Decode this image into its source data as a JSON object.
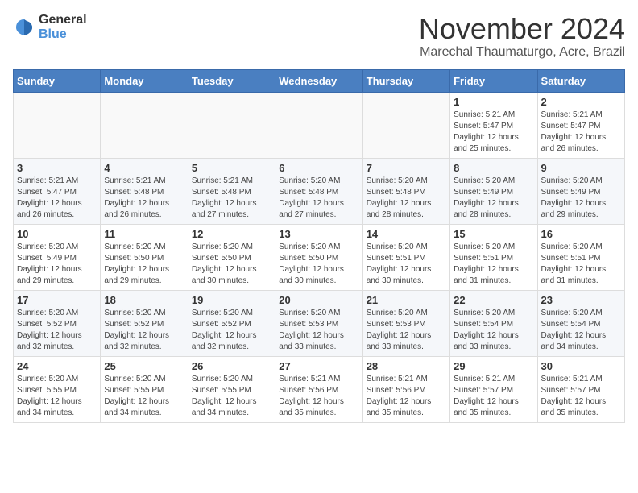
{
  "logo": {
    "general": "General",
    "blue": "Blue"
  },
  "header": {
    "month_year": "November 2024",
    "location": "Marechal Thaumaturgo, Acre, Brazil"
  },
  "weekdays": [
    "Sunday",
    "Monday",
    "Tuesday",
    "Wednesday",
    "Thursday",
    "Friday",
    "Saturday"
  ],
  "weeks": [
    [
      {
        "day": "",
        "info": ""
      },
      {
        "day": "",
        "info": ""
      },
      {
        "day": "",
        "info": ""
      },
      {
        "day": "",
        "info": ""
      },
      {
        "day": "",
        "info": ""
      },
      {
        "day": "1",
        "info": "Sunrise: 5:21 AM\nSunset: 5:47 PM\nDaylight: 12 hours\nand 25 minutes."
      },
      {
        "day": "2",
        "info": "Sunrise: 5:21 AM\nSunset: 5:47 PM\nDaylight: 12 hours\nand 26 minutes."
      }
    ],
    [
      {
        "day": "3",
        "info": "Sunrise: 5:21 AM\nSunset: 5:47 PM\nDaylight: 12 hours\nand 26 minutes."
      },
      {
        "day": "4",
        "info": "Sunrise: 5:21 AM\nSunset: 5:48 PM\nDaylight: 12 hours\nand 26 minutes."
      },
      {
        "day": "5",
        "info": "Sunrise: 5:21 AM\nSunset: 5:48 PM\nDaylight: 12 hours\nand 27 minutes."
      },
      {
        "day": "6",
        "info": "Sunrise: 5:20 AM\nSunset: 5:48 PM\nDaylight: 12 hours\nand 27 minutes."
      },
      {
        "day": "7",
        "info": "Sunrise: 5:20 AM\nSunset: 5:48 PM\nDaylight: 12 hours\nand 28 minutes."
      },
      {
        "day": "8",
        "info": "Sunrise: 5:20 AM\nSunset: 5:49 PM\nDaylight: 12 hours\nand 28 minutes."
      },
      {
        "day": "9",
        "info": "Sunrise: 5:20 AM\nSunset: 5:49 PM\nDaylight: 12 hours\nand 29 minutes."
      }
    ],
    [
      {
        "day": "10",
        "info": "Sunrise: 5:20 AM\nSunset: 5:49 PM\nDaylight: 12 hours\nand 29 minutes."
      },
      {
        "day": "11",
        "info": "Sunrise: 5:20 AM\nSunset: 5:50 PM\nDaylight: 12 hours\nand 29 minutes."
      },
      {
        "day": "12",
        "info": "Sunrise: 5:20 AM\nSunset: 5:50 PM\nDaylight: 12 hours\nand 30 minutes."
      },
      {
        "day": "13",
        "info": "Sunrise: 5:20 AM\nSunset: 5:50 PM\nDaylight: 12 hours\nand 30 minutes."
      },
      {
        "day": "14",
        "info": "Sunrise: 5:20 AM\nSunset: 5:51 PM\nDaylight: 12 hours\nand 30 minutes."
      },
      {
        "day": "15",
        "info": "Sunrise: 5:20 AM\nSunset: 5:51 PM\nDaylight: 12 hours\nand 31 minutes."
      },
      {
        "day": "16",
        "info": "Sunrise: 5:20 AM\nSunset: 5:51 PM\nDaylight: 12 hours\nand 31 minutes."
      }
    ],
    [
      {
        "day": "17",
        "info": "Sunrise: 5:20 AM\nSunset: 5:52 PM\nDaylight: 12 hours\nand 32 minutes."
      },
      {
        "day": "18",
        "info": "Sunrise: 5:20 AM\nSunset: 5:52 PM\nDaylight: 12 hours\nand 32 minutes."
      },
      {
        "day": "19",
        "info": "Sunrise: 5:20 AM\nSunset: 5:52 PM\nDaylight: 12 hours\nand 32 minutes."
      },
      {
        "day": "20",
        "info": "Sunrise: 5:20 AM\nSunset: 5:53 PM\nDaylight: 12 hours\nand 33 minutes."
      },
      {
        "day": "21",
        "info": "Sunrise: 5:20 AM\nSunset: 5:53 PM\nDaylight: 12 hours\nand 33 minutes."
      },
      {
        "day": "22",
        "info": "Sunrise: 5:20 AM\nSunset: 5:54 PM\nDaylight: 12 hours\nand 33 minutes."
      },
      {
        "day": "23",
        "info": "Sunrise: 5:20 AM\nSunset: 5:54 PM\nDaylight: 12 hours\nand 34 minutes."
      }
    ],
    [
      {
        "day": "24",
        "info": "Sunrise: 5:20 AM\nSunset: 5:55 PM\nDaylight: 12 hours\nand 34 minutes."
      },
      {
        "day": "25",
        "info": "Sunrise: 5:20 AM\nSunset: 5:55 PM\nDaylight: 12 hours\nand 34 minutes."
      },
      {
        "day": "26",
        "info": "Sunrise: 5:20 AM\nSunset: 5:55 PM\nDaylight: 12 hours\nand 34 minutes."
      },
      {
        "day": "27",
        "info": "Sunrise: 5:21 AM\nSunset: 5:56 PM\nDaylight: 12 hours\nand 35 minutes."
      },
      {
        "day": "28",
        "info": "Sunrise: 5:21 AM\nSunset: 5:56 PM\nDaylight: 12 hours\nand 35 minutes."
      },
      {
        "day": "29",
        "info": "Sunrise: 5:21 AM\nSunset: 5:57 PM\nDaylight: 12 hours\nand 35 minutes."
      },
      {
        "day": "30",
        "info": "Sunrise: 5:21 AM\nSunset: 5:57 PM\nDaylight: 12 hours\nand 35 minutes."
      }
    ]
  ]
}
